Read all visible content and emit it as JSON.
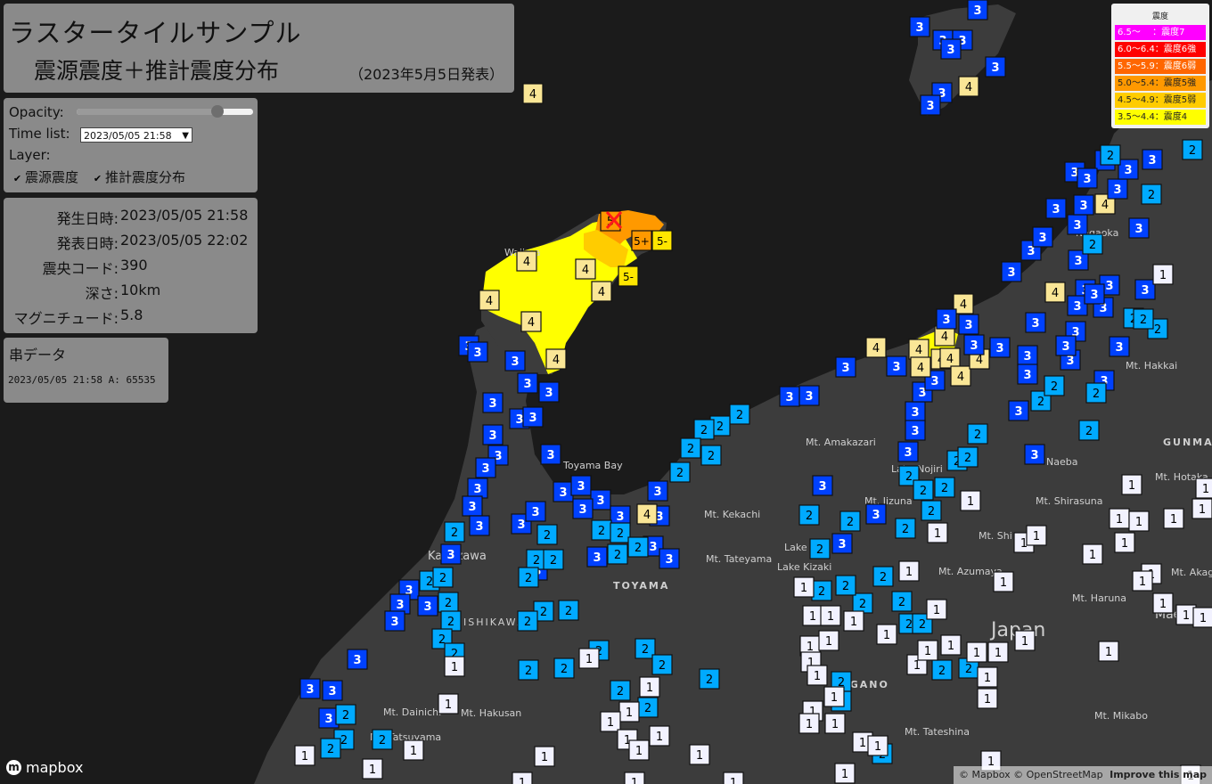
{
  "title": {
    "main": "ラスタータイルサンプル",
    "sub": "震源震度＋推計震度分布",
    "date": "（2023年5月5日発表）"
  },
  "controls": {
    "opacity_label": "Opacity:",
    "opacity_value": 0.8,
    "timelist_label": "Time list:",
    "timelist_value": "2023/05/05 21:58",
    "layer_label": "Layer:",
    "layer_epicenter": "震源震度",
    "layer_estimated": "推計震度分布",
    "layer_epicenter_checked": true,
    "layer_estimated_checked": true
  },
  "info": {
    "rows": [
      {
        "label": "発生日時:",
        "value": "2023/05/05 21:58"
      },
      {
        "label": "発表日時:",
        "value": "2023/05/05 22:02"
      },
      {
        "label": "震央コード:",
        "value": "390"
      },
      {
        "label": "深さ:",
        "value": "10km"
      },
      {
        "label": "マグニチュード:",
        "value": "5.8"
      }
    ]
  },
  "serial": {
    "title": "串データ",
    "text": "2023/05/05 21:58 A: 65535"
  },
  "legend": {
    "title": "震度",
    "items": [
      {
        "text": "6.5～　 ：震度7",
        "bg": "#ff00ff",
        "fg": "#ffffff"
      },
      {
        "text": "6.0～6.4：震度6強",
        "bg": "#ff0000",
        "fg": "#ffffff"
      },
      {
        "text": "5.5～5.9：震度6弱",
        "bg": "#ff6600",
        "fg": "#ffffff"
      },
      {
        "text": "5.0～5.4：震度5強",
        "bg": "#ff9900",
        "fg": "#222222"
      },
      {
        "text": "4.5～4.9：震度5弱",
        "bg": "#ffcc00",
        "fg": "#222222"
      },
      {
        "text": "3.5～4.4：震度4",
        "bg": "#ffff00",
        "fg": "#222222"
      }
    ]
  },
  "intensity_colors": {
    "1": {
      "bg": "#f2f2ff",
      "fg": "#000000"
    },
    "2": {
      "bg": "#00aaff",
      "fg": "#000000"
    },
    "3": {
      "bg": "#0041ff",
      "fg": "#ffffff"
    },
    "4": {
      "bg": "#fae696",
      "fg": "#000000"
    },
    "5-": {
      "bg": "#ffe600",
      "fg": "#000000"
    },
    "5+": {
      "bg": "#ff9900",
      "fg": "#000000"
    },
    "5": {
      "bg": "#ff9900",
      "fg": "#000000"
    }
  },
  "map_labels": [
    "Toyama Bay",
    "Mt. Amakazari",
    "Mt. Kekachi",
    "Mt. Tateyama",
    "TOYAMA",
    "Kanazawa",
    "ISHIKAWA",
    "Mt. Dainichi",
    "Mt. Hakusan",
    "Mt. Tatsuyama",
    "Mt. Iizuna",
    "Mt. Shirasuna",
    "Mt. Azumaya",
    "Lake Kizaki",
    "Lake",
    "NAGANO",
    "Mt. Tateshina",
    "Japan",
    "Mt. Haruna",
    "Maebashi",
    "Mt. Mikabo",
    "Mt. Hakkai",
    "Naeba",
    "GUNMA",
    "Mt. Hotaka",
    "Mt. Akag",
    "Mt. Shi",
    "Lake Nojiri",
    "Nagaoka",
    "Wajima"
  ],
  "mapbox_logo": "mapbox",
  "attribution": "© Mapbox © OpenStreetMap",
  "improve": "Improve this map"
}
